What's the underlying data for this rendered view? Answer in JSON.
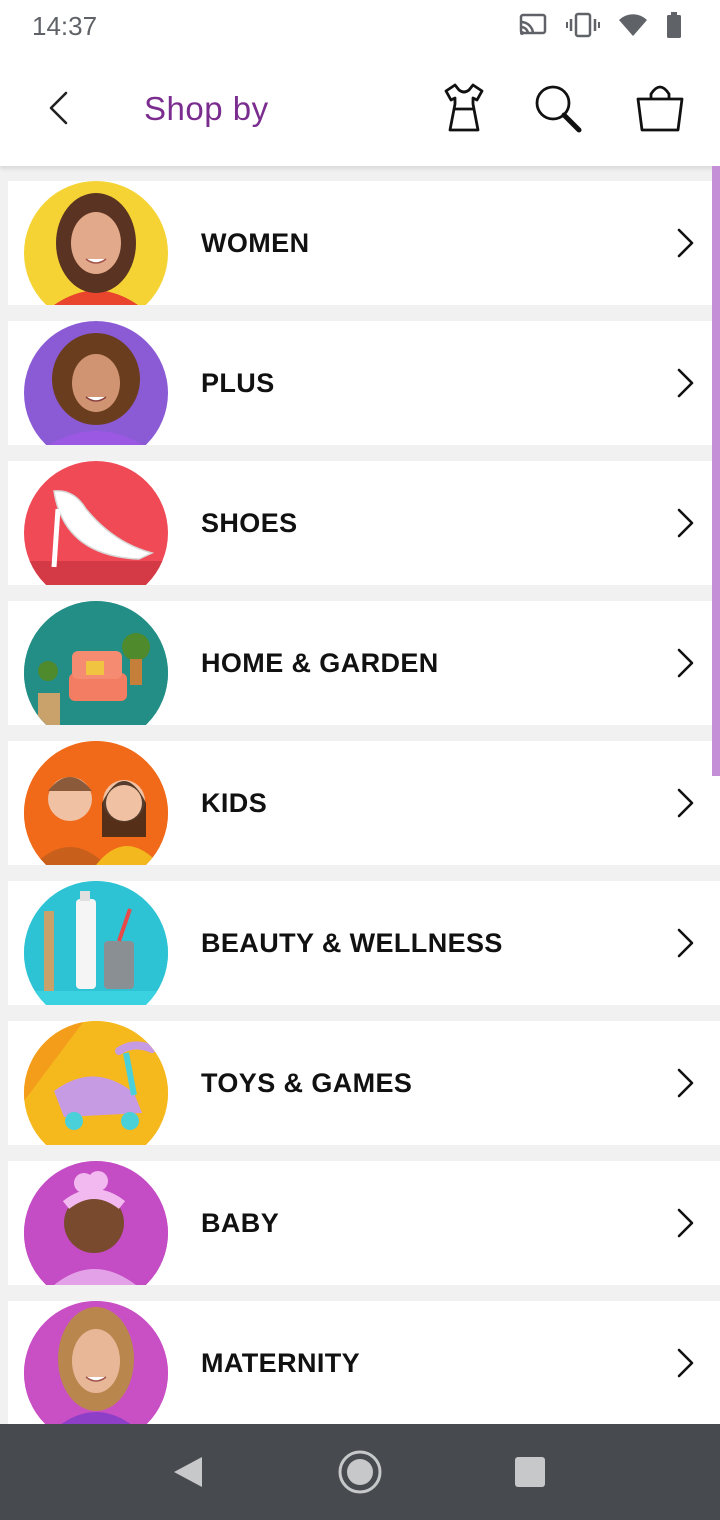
{
  "status_bar": {
    "time": "14:37"
  },
  "header": {
    "title": "Shop by",
    "accent_color": "#7a2d8f"
  },
  "categories": [
    {
      "label": "WOMEN",
      "thumb_bg": "#f5d334",
      "thumb_icon": "woman-portrait-image"
    },
    {
      "label": "PLUS",
      "thumb_bg": "#8b5bd6",
      "thumb_icon": "plus-model-portrait-image"
    },
    {
      "label": "SHOES",
      "thumb_bg": "#ef4a55",
      "thumb_icon": "white-heel-shoe-image"
    },
    {
      "label": "HOME & GARDEN",
      "thumb_bg": "#1f8f86",
      "thumb_icon": "armchair-plants-image"
    },
    {
      "label": "KIDS",
      "thumb_bg": "#f0701e",
      "thumb_icon": "two-kids-image"
    },
    {
      "label": "BEAUTY & WELLNESS",
      "thumb_bg": "#2ec3d4",
      "thumb_icon": "beauty-products-image"
    },
    {
      "label": "TOYS & GAMES",
      "thumb_bg": "#f3b11b",
      "thumb_icon": "ride-on-toy-image"
    },
    {
      "label": "BABY",
      "thumb_bg": "#c44cc4",
      "thumb_icon": "baby-headband-image"
    },
    {
      "label": "MATERNITY",
      "thumb_bg": "#c94fc4",
      "thumb_icon": "maternity-model-image"
    }
  ]
}
